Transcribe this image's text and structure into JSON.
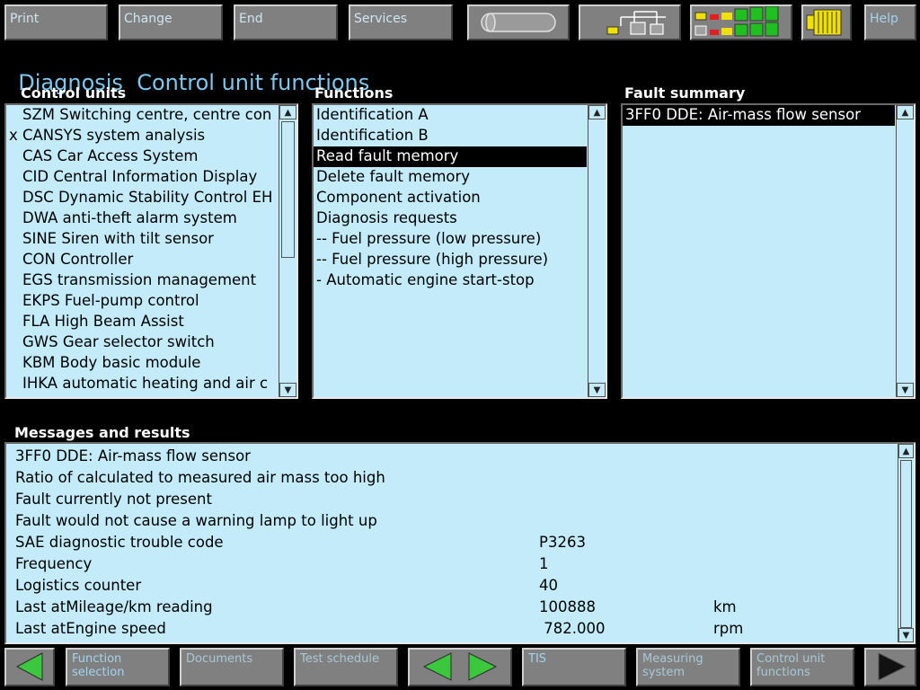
{
  "toolbar": {
    "print": "Print",
    "change": "Change",
    "end": "End",
    "services": "Services",
    "help": "Help"
  },
  "title": {
    "main": "Diagnosis",
    "sub": "Control unit functions"
  },
  "control_units": {
    "label": "Control units",
    "items": [
      {
        "mark": "",
        "text": "SZM Switching centre, centre con"
      },
      {
        "mark": "x",
        "text": "CANSYS system analysis"
      },
      {
        "mark": "",
        "text": "CAS Car Access System"
      },
      {
        "mark": "",
        "text": "CID Central Information Display"
      },
      {
        "mark": "",
        "text": "DSC Dynamic Stability Control EH"
      },
      {
        "mark": "",
        "text": "DWA anti-theft alarm system"
      },
      {
        "mark": "",
        "text": "SINE Siren with tilt sensor"
      },
      {
        "mark": "",
        "text": "CON Controller"
      },
      {
        "mark": "",
        "text": "EGS transmission management"
      },
      {
        "mark": "",
        "text": "EKPS Fuel-pump control"
      },
      {
        "mark": "",
        "text": "FLA High Beam Assist"
      },
      {
        "mark": "",
        "text": "GWS Gear selector switch"
      },
      {
        "mark": "",
        "text": "KBM Body basic module"
      },
      {
        "mark": "",
        "text": "IHKA automatic heating and air c"
      }
    ]
  },
  "functions": {
    "label": "Functions",
    "selected": "Read fault memory",
    "items": [
      "Identification A",
      "Identification B",
      "Read fault memory",
      "Delete fault memory",
      "Component activation",
      "Diagnosis requests",
      "-- Fuel pressure (low pressure)",
      "-- Fuel pressure (high pressure)",
      "- Automatic engine start-stop"
    ]
  },
  "fault_summary": {
    "label": "Fault summary",
    "items": [
      "3FF0 DDE: Air-mass flow sensor"
    ]
  },
  "messages": {
    "label": "Messages and results",
    "rows": [
      {
        "text": "3FF0 DDE: Air-mass flow sensor",
        "value": "",
        "unit": ""
      },
      {
        "text": "Ratio of calculated to measured air mass too high",
        "value": "",
        "unit": ""
      },
      {
        "text": "Fault currently not present",
        "value": "",
        "unit": ""
      },
      {
        "text": "Fault would not cause a warning lamp to light up",
        "value": "",
        "unit": ""
      },
      {
        "text": "SAE diagnostic trouble code",
        "value": "P3263",
        "unit": ""
      },
      {
        "text": "Frequency",
        "value": "1",
        "unit": ""
      },
      {
        "text": "Logistics counter",
        "value": "40",
        "unit": ""
      },
      {
        "text": "Last atMileage/km reading",
        "value": "100888",
        "unit": "km"
      },
      {
        "text": "Last atEngine speed",
        "value": " 782.000",
        "unit": "rpm"
      }
    ]
  },
  "bottom_bar": {
    "function_selection": "Function selection",
    "documents": "Documents",
    "test_schedule": "Test schedule",
    "tis": "TIS",
    "measuring_system": "Measuring system",
    "control_unit_functions": "Control unit functions"
  },
  "colors": {
    "panel_bg": "#c3ebfa",
    "title": "#7ec8ee",
    "arrow_green": "#3cc83c",
    "status_green": "#20c020",
    "status_red": "#e02020",
    "status_yellow": "#f0e000"
  }
}
